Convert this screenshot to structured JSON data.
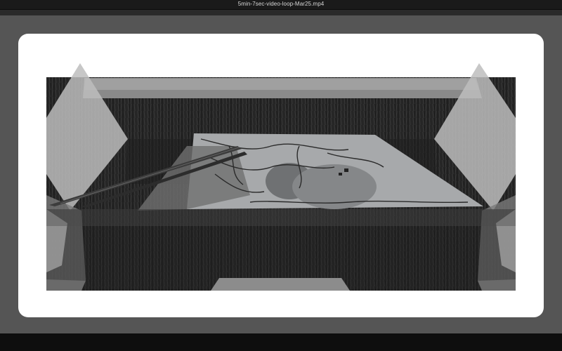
{
  "window": {
    "title": "5min-7sec-video-loop-Mar25.mp4"
  },
  "player": {
    "content": "video-frame",
    "background_color": "#555555",
    "frame_color": "#ffffff"
  }
}
